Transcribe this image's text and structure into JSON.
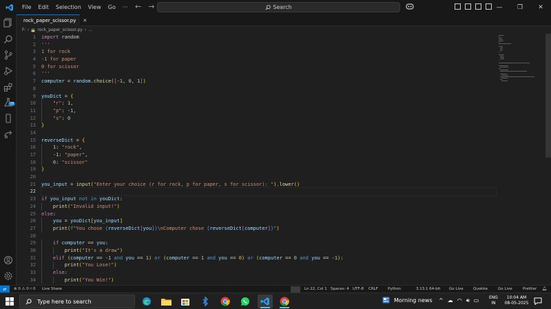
{
  "titlebar": {
    "menu": [
      "File",
      "Edit",
      "Selection",
      "View",
      "Go",
      "···"
    ],
    "search_label": "Search"
  },
  "tab": {
    "filename": "rock_paper_scissor.py"
  },
  "breadcrumb": {
    "root": "F:",
    "file": "rock_paper_scissor.py",
    "more": "..."
  },
  "editor": {
    "current_line": 22,
    "lines": [
      [
        [
          "kw",
          "import"
        ],
        [
          "t",
          " random"
        ]
      ],
      [
        [
          "str",
          "'''"
        ]
      ],
      [
        [
          "str",
          "1 for rock"
        ]
      ],
      [
        [
          "str",
          "-1 for paper"
        ]
      ],
      [
        [
          "str",
          "0 for scissor"
        ]
      ],
      [
        [
          "str",
          "'''"
        ]
      ],
      [
        [
          "var",
          "computer"
        ],
        [
          "op",
          " = "
        ],
        [
          "var",
          "random"
        ],
        [
          "op",
          "."
        ],
        [
          "fn",
          "choice"
        ],
        [
          "br1",
          "("
        ],
        [
          "br2",
          "["
        ],
        [
          "op",
          "-"
        ],
        [
          "num",
          "1"
        ],
        [
          "op",
          ", "
        ],
        [
          "num",
          "0"
        ],
        [
          "op",
          ", "
        ],
        [
          "num",
          "1"
        ],
        [
          "br2",
          "]"
        ],
        [
          "br1",
          ")"
        ]
      ],
      [],
      [
        [
          "var",
          "youDict"
        ],
        [
          "op",
          " = "
        ],
        [
          "br1",
          "{"
        ]
      ],
      [
        [
          "t",
          "    "
        ],
        [
          "str",
          "\"r\""
        ],
        [
          "op",
          ": "
        ],
        [
          "num",
          "1"
        ],
        [
          "op",
          ","
        ]
      ],
      [
        [
          "t",
          "    "
        ],
        [
          "str",
          "\"p\""
        ],
        [
          "op",
          ": -"
        ],
        [
          "num",
          "1"
        ],
        [
          "op",
          ","
        ]
      ],
      [
        [
          "t",
          "    "
        ],
        [
          "str",
          "\"s\""
        ],
        [
          "op",
          ": "
        ],
        [
          "num",
          "0"
        ]
      ],
      [
        [
          "br1",
          "}"
        ]
      ],
      [],
      [
        [
          "var",
          "reverseDict"
        ],
        [
          "op",
          " = "
        ],
        [
          "br1",
          "{"
        ]
      ],
      [
        [
          "t",
          "    "
        ],
        [
          "num",
          "1"
        ],
        [
          "op",
          ": "
        ],
        [
          "str",
          "\"rock\""
        ],
        [
          "op",
          ","
        ]
      ],
      [
        [
          "t",
          "    "
        ],
        [
          "op",
          "-"
        ],
        [
          "num",
          "1"
        ],
        [
          "op",
          ": "
        ],
        [
          "str",
          "\"paper\""
        ],
        [
          "op",
          ","
        ]
      ],
      [
        [
          "t",
          "    "
        ],
        [
          "num",
          "0"
        ],
        [
          "op",
          ": "
        ],
        [
          "str",
          "\"scissor\""
        ]
      ],
      [
        [
          "br1",
          "}"
        ]
      ],
      [],
      [
        [
          "var",
          "you_input"
        ],
        [
          "op",
          " = "
        ],
        [
          "fn",
          "input"
        ],
        [
          "br1",
          "("
        ],
        [
          "str",
          "\"Enter your choice (r for rock, p for paper, s for scissor): \""
        ],
        [
          "br1",
          ")"
        ],
        [
          "op",
          "."
        ],
        [
          "fn",
          "lower"
        ],
        [
          "br1",
          "()"
        ]
      ],
      [],
      [
        [
          "kw",
          "if"
        ],
        [
          "var",
          " you_input "
        ],
        [
          "kw2",
          "not in"
        ],
        [
          "var",
          " youDict"
        ],
        [
          "op",
          ":"
        ]
      ],
      [
        [
          "t",
          "    "
        ],
        [
          "fn",
          "print"
        ],
        [
          "br1",
          "("
        ],
        [
          "str",
          "\"Invalid input!\""
        ],
        [
          "br1",
          ")"
        ]
      ],
      [
        [
          "kw",
          "else"
        ],
        [
          "op",
          ":"
        ]
      ],
      [
        [
          "t",
          "    "
        ],
        [
          "var",
          "you"
        ],
        [
          "op",
          " = "
        ],
        [
          "var",
          "youDict"
        ],
        [
          "br1",
          "["
        ],
        [
          "var",
          "you_input"
        ],
        [
          "br1",
          "]"
        ]
      ],
      [
        [
          "t",
          "    "
        ],
        [
          "fn",
          "print"
        ],
        [
          "br1",
          "("
        ],
        [
          "kw2",
          "f"
        ],
        [
          "str",
          "\"You chose "
        ],
        [
          "br3",
          "{"
        ],
        [
          "var",
          "reverseDict"
        ],
        [
          "br2",
          "["
        ],
        [
          "var",
          "you"
        ],
        [
          "br2",
          "]"
        ],
        [
          "br3",
          "}"
        ],
        [
          "str",
          "\\nComputer chose "
        ],
        [
          "br3",
          "{"
        ],
        [
          "var",
          "reverseDict"
        ],
        [
          "br2",
          "["
        ],
        [
          "var",
          "computer"
        ],
        [
          "br2",
          "]"
        ],
        [
          "br3",
          "}"
        ],
        [
          "str",
          "\""
        ],
        [
          "br1",
          ")"
        ]
      ],
      [],
      [
        [
          "t",
          "    "
        ],
        [
          "kw",
          "if"
        ],
        [
          "var",
          " computer "
        ],
        [
          "op",
          "== "
        ],
        [
          "var",
          "you"
        ],
        [
          "op",
          ":"
        ]
      ],
      [
        [
          "t",
          "        "
        ],
        [
          "fn",
          "print"
        ],
        [
          "br1",
          "("
        ],
        [
          "str",
          "\"It's a draw\""
        ],
        [
          "br1",
          ")"
        ]
      ],
      [
        [
          "t",
          "    "
        ],
        [
          "kw",
          "elif"
        ],
        [
          "op",
          " "
        ],
        [
          "br1",
          "("
        ],
        [
          "var",
          "computer"
        ],
        [
          "op",
          " == -"
        ],
        [
          "num",
          "1"
        ],
        [
          "op",
          " "
        ],
        [
          "kw2",
          "and"
        ],
        [
          "var",
          " you"
        ],
        [
          "op",
          " == "
        ],
        [
          "num",
          "1"
        ],
        [
          "br1",
          ")"
        ],
        [
          "op",
          " "
        ],
        [
          "kw2",
          "or"
        ],
        [
          "op",
          " "
        ],
        [
          "br1",
          "("
        ],
        [
          "var",
          "computer"
        ],
        [
          "op",
          " == "
        ],
        [
          "num",
          "1"
        ],
        [
          "op",
          " "
        ],
        [
          "kw2",
          "and"
        ],
        [
          "var",
          " you"
        ],
        [
          "op",
          " == "
        ],
        [
          "num",
          "0"
        ],
        [
          "br1",
          ")"
        ],
        [
          "op",
          " "
        ],
        [
          "kw2",
          "or"
        ],
        [
          "op",
          " "
        ],
        [
          "br1",
          "("
        ],
        [
          "var",
          "computer"
        ],
        [
          "op",
          " == "
        ],
        [
          "num",
          "0"
        ],
        [
          "op",
          " "
        ],
        [
          "kw2",
          "and"
        ],
        [
          "var",
          " you"
        ],
        [
          "op",
          " == -"
        ],
        [
          "num",
          "1"
        ],
        [
          "br1",
          ")"
        ],
        [
          "op",
          ":"
        ]
      ],
      [
        [
          "t",
          "        "
        ],
        [
          "fn",
          "print"
        ],
        [
          "br1",
          "("
        ],
        [
          "str",
          "\"You Lose!\""
        ],
        [
          "br1",
          ")"
        ]
      ],
      [
        [
          "t",
          "    "
        ],
        [
          "kw",
          "else"
        ],
        [
          "op",
          ":"
        ]
      ],
      [
        [
          "t",
          "        "
        ],
        [
          "fn",
          "print"
        ],
        [
          "br1",
          "("
        ],
        [
          "str",
          "\"You Win!\""
        ],
        [
          "br1",
          ")"
        ]
      ]
    ]
  },
  "statusbar": {
    "problems": "⊗ 0 ⚠ 0",
    "ports": "⑁ 0",
    "live_share": "Live Share",
    "position": "Ln 22, Col 1",
    "spaces": "Spaces: 4",
    "encoding": "UTF-8",
    "eol": "CRLF",
    "language": "Python",
    "interpreter": "3.13.1 64-bit",
    "go_live_1": "Go Live",
    "quokka": "Quokka",
    "go_live_2": "Go Live",
    "prettier": "Prettier"
  },
  "taskbar": {
    "search_placeholder": "Type here to search",
    "news": "Morning news",
    "lang_top": "ENG",
    "lang_bottom": "IN",
    "time": "10:04 AM",
    "date": "08-05-2025"
  },
  "colors": {
    "accent": "#0078d4",
    "editor_bg": "#1f1f1f",
    "chrome_bg": "#181818",
    "taskbar_bg": "#202020"
  }
}
